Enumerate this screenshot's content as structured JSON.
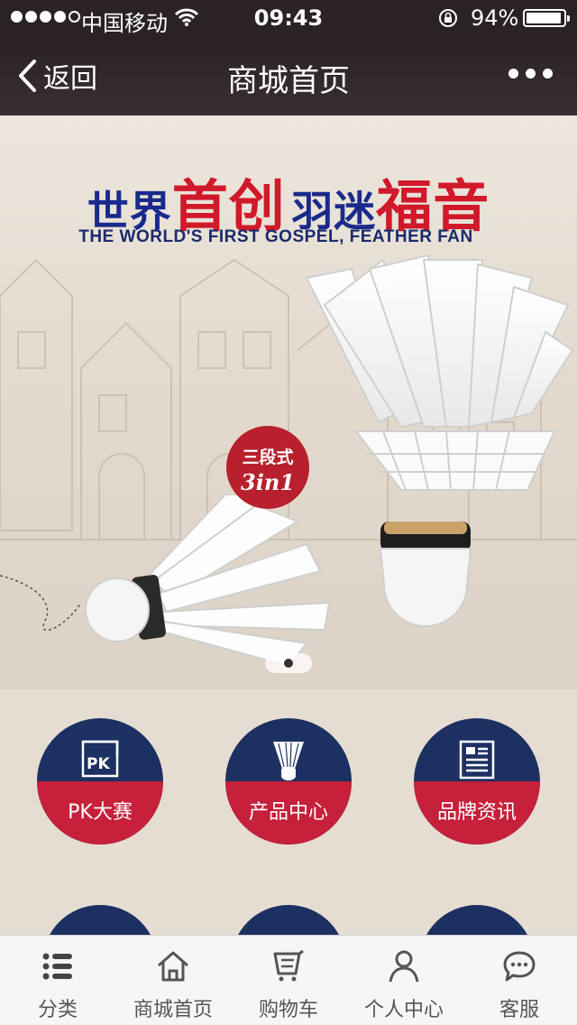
{
  "status_bar": {
    "carrier": "中国移动",
    "time": "09:43",
    "battery_percent": "94%",
    "battery_level": 0.94,
    "signal_bars_filled": 4,
    "signal_bars_total": 5
  },
  "nav": {
    "back_label": "返回",
    "title": "商城首页"
  },
  "banner": {
    "headline_part1": "世界",
    "headline_part2": "首创",
    "headline_part3": "羽迷",
    "headline_part4": "福音",
    "subline": "THE WORLD'S FIRST GOSPEL, FEATHER FAN",
    "badge_zh": "三段式",
    "badge_en": "3in1",
    "pages": 1,
    "active_page": 1,
    "colors": {
      "headline_blue": "#1a2a8c",
      "headline_red": "#d0192a",
      "badge": "#b7202c"
    }
  },
  "menu": {
    "items": [
      {
        "label": "PK大赛",
        "icon": "pk-icon"
      },
      {
        "label": "产品中心",
        "icon": "shuttlecock-icon"
      },
      {
        "label": "品牌资讯",
        "icon": "news-icon"
      }
    ],
    "colors": {
      "top": "#1d3062",
      "bottom": "#c6203a"
    }
  },
  "tabbar": {
    "items": [
      {
        "label": "分类",
        "icon": "list-icon"
      },
      {
        "label": "商城首页",
        "icon": "home-icon"
      },
      {
        "label": "购物车",
        "icon": "cart-icon"
      },
      {
        "label": "个人中心",
        "icon": "user-icon"
      },
      {
        "label": "客服",
        "icon": "chat-icon"
      }
    ]
  }
}
